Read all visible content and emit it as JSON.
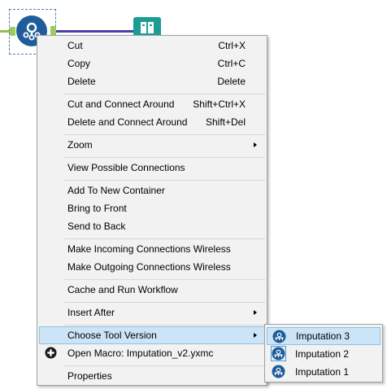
{
  "canvas": {
    "left_tool_icon": "imputation-macro-icon",
    "right_tool_icon": "book-tool-icon",
    "colors": {
      "tool_blue": "#1f5c9a",
      "anchor_green": "#9ccc5a",
      "connection_purple": "#4b3fa8",
      "teal_tool": "#1a9e93"
    }
  },
  "menu": {
    "items": {
      "cut": {
        "label": "Cut",
        "shortcut": "Ctrl+X"
      },
      "copy": {
        "label": "Copy",
        "shortcut": "Ctrl+C"
      },
      "delete": {
        "label": "Delete",
        "shortcut": "Delete"
      },
      "cut_connect": {
        "label": "Cut and Connect Around",
        "shortcut": "Shift+Ctrl+X"
      },
      "delete_connect": {
        "label": "Delete and Connect Around",
        "shortcut": "Shift+Del"
      },
      "zoom": {
        "label": "Zoom"
      },
      "view_connections": {
        "label": "View Possible Connections"
      },
      "add_container": {
        "label": "Add To New Container"
      },
      "bring_front": {
        "label": "Bring to Front"
      },
      "send_back": {
        "label": "Send to Back"
      },
      "incoming_wireless": {
        "label": "Make Incoming Connections Wireless"
      },
      "outgoing_wireless": {
        "label": "Make Outgoing Connections Wireless"
      },
      "cache_run": {
        "label": "Cache and Run Workflow"
      },
      "insert_after": {
        "label": "Insert After"
      },
      "choose_version": {
        "label": "Choose Tool Version"
      },
      "open_macro": {
        "label": "Open Macro: Imputation_v2.yxmc",
        "icon": "plus-circle-icon"
      },
      "properties": {
        "label": "Properties"
      }
    }
  },
  "submenu": {
    "items": [
      {
        "label": "Imputation 3",
        "icon": "imputation-icon",
        "highlighted": true
      },
      {
        "label": "Imputation 2",
        "icon": "imputation-icon",
        "selected": true
      },
      {
        "label": "Imputation 1",
        "icon": "imputation-icon"
      }
    ]
  },
  "colors": {
    "menu_bg": "#f2f2f2",
    "highlight_bg": "#cce4f7",
    "highlight_border": "#92c0e0"
  }
}
